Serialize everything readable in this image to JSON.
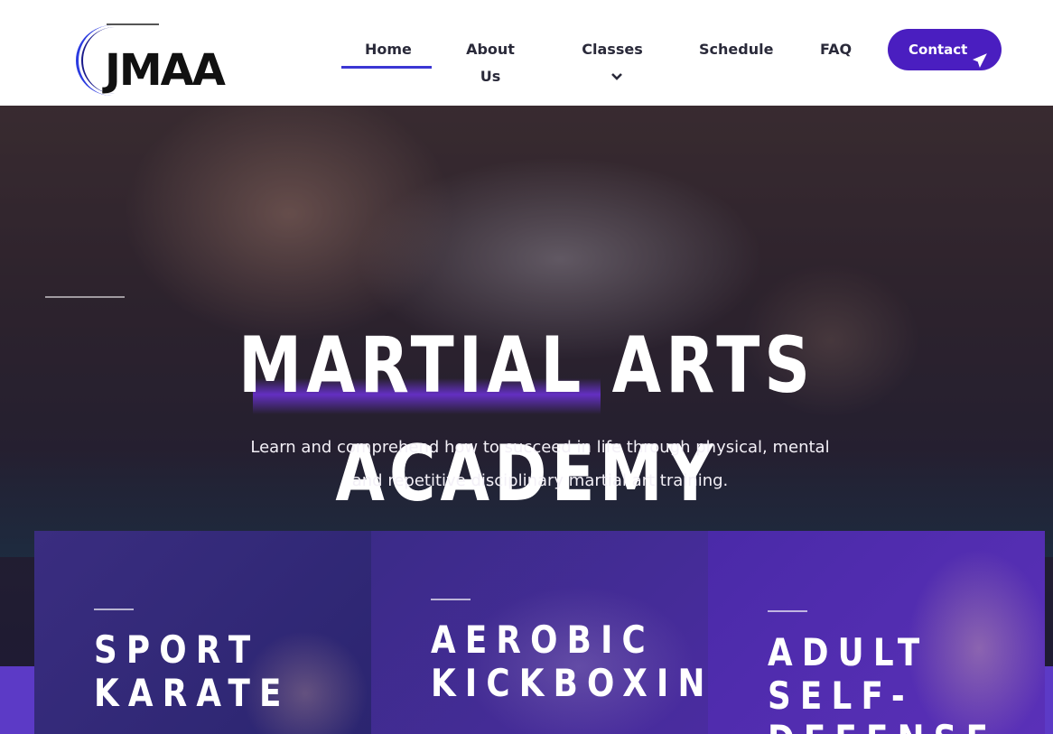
{
  "brand": {
    "logo_text": "JMAA"
  },
  "nav": {
    "items": [
      {
        "label": "Home",
        "active": true
      },
      {
        "label": "About Us"
      },
      {
        "label": "Classes",
        "has_dropdown": true,
        "icon": "chevron-down-icon"
      },
      {
        "label": "Schedule"
      },
      {
        "label": "FAQ"
      }
    ],
    "contact": {
      "label": "Contact",
      "icon": "paper-plane-icon"
    }
  },
  "hero": {
    "title": "MARTIAL ARTS ACADEMY",
    "subtitle_line1": "Learn and comprehend how to succeed in life through physical, mental",
    "subtitle_line2": "and repetitive disciplinary martial art training."
  },
  "cards": [
    {
      "line1": "SPORT",
      "line2": "KARATE"
    },
    {
      "line1": "AEROBIC",
      "line2": "KICKBOXING"
    },
    {
      "line1": "ADULT",
      "line2": "SELF-",
      "line3": "DEFENSE"
    }
  ],
  "colors": {
    "accent": "#4a1ec0",
    "nav_underline": "#3b36d4",
    "logo_arc": "#2b3be0",
    "band": "#5c3ac6"
  }
}
